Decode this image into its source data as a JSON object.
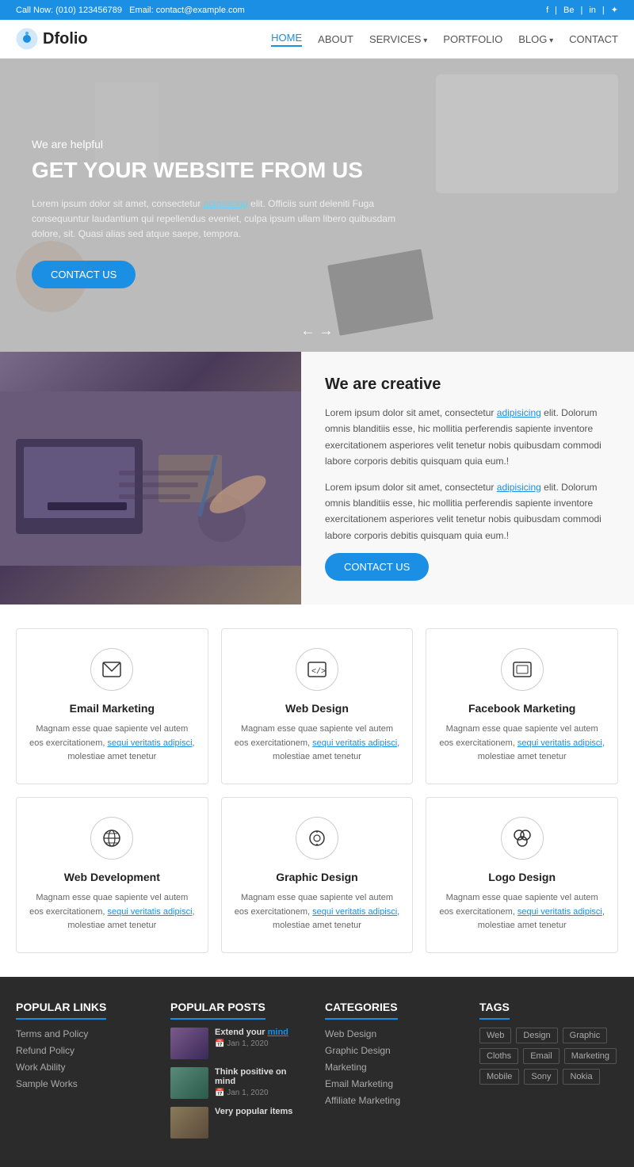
{
  "topbar": {
    "call_label": "Call Now:",
    "phone": "(010) 123456789",
    "email_label": "Email:",
    "email": "contact@example.com",
    "social": [
      "f",
      "Be",
      "in",
      "🐦"
    ]
  },
  "header": {
    "logo_text": "Dfolio",
    "nav": [
      {
        "label": "HOME",
        "active": true,
        "has_arrow": false
      },
      {
        "label": "ABOUT",
        "active": false,
        "has_arrow": false
      },
      {
        "label": "SERVICES",
        "active": false,
        "has_arrow": true
      },
      {
        "label": "PORTFOLIO",
        "active": false,
        "has_arrow": false
      },
      {
        "label": "BLOG",
        "active": false,
        "has_arrow": true
      },
      {
        "label": "CONTACT",
        "active": false,
        "has_arrow": false
      }
    ]
  },
  "hero": {
    "subtitle": "We are helpful",
    "title": "GET YOUR WEBSITE FROM US",
    "description": "Lorem ipsum dolor sit amet, consectetur adipisicing elit. Officiis sunt deleniti Fuga consequuntur laudantium qui repellendus eveniet, culpa ipsum ullam libero quibusdam dolore, sit. Quasi alias sed atque saepe, tempora.",
    "cta_button": "CONTACT US",
    "arrows": "← →"
  },
  "about": {
    "title": "We are creative",
    "text1": "Lorem ipsum dolor sit amet, consectetur adipisicing elit. Dolorum omnis blanditiis esse, hic mollitia perferendis sapiente inventore exercitationem asperiores velit tenetur nobis quibusdam commodi labore corporis debitis quisquam quia eum.!",
    "text2": "Lorem ipsum dolor sit amet, consectetur adipisicing elit. Dolorum omnis blanditiis esse, hic mollitia perferendis sapiente inventore exercitationem asperiores velit tenetur nobis quibusdam commodi labore corporis debitis quisquam quia eum.!",
    "cta_button": "CONTACT US"
  },
  "services": [
    {
      "icon": "✉",
      "title": "Email Marketing",
      "desc": "Magnam esse quae sapiente vel autem eos exercitationem, sequi veritatis adipisci, molestiae amet tenetur"
    },
    {
      "icon": "</>",
      "title": "Web Design",
      "desc": "Magnam esse quae sapiente vel autem eos exercitationem, sequi veritatis adipisci, molestiae amet tenetur"
    },
    {
      "icon": "▣",
      "title": "Facebook Marketing",
      "desc": "Magnam esse quae sapiente vel autem eos exercitationem, sequi veritatis adipisci, molestiae amet tenetur"
    },
    {
      "icon": "🌐",
      "title": "Web Development",
      "desc": "Magnam esse quae sapiente vel autem eos exercitationem, sequi veritatis adipisci, molestiae amet tenetur"
    },
    {
      "icon": "📷",
      "title": "Graphic Design",
      "desc": "Magnam esse quae sapiente vel autem eos exercitationem, sequi veritatis adipisci, molestiae amet tenetur"
    },
    {
      "icon": "◎",
      "title": "Logo Design",
      "desc": "Magnam esse quae sapiente vel autem eos exercitationem, sequi veritatis adipisci, molestiae amet tenetur"
    }
  ],
  "footer": {
    "popular_links": {
      "title": "POPULAR LINKS",
      "items": [
        "Terms and Policy",
        "Refund Policy",
        "Work Ability",
        "Sample Works"
      ]
    },
    "popular_posts": {
      "title": "POPULAR POSTS",
      "posts": [
        {
          "title": "Extend your mind",
          "title_highlight": "mind",
          "date": "Jan 1, 2020"
        },
        {
          "title": "Think positive on mind",
          "date": "Jan 1, 2020"
        },
        {
          "title": "Very popular items",
          "date": ""
        }
      ]
    },
    "categories": {
      "title": "CATEGORIES",
      "items": [
        "Web Design",
        "Graphic Design",
        "Marketing",
        "Email Marketing",
        "Affiliate Marketing"
      ]
    },
    "tags": {
      "title": "TAGS",
      "items": [
        "Web",
        "Design",
        "Graphic",
        "Cloths",
        "Email",
        "Marketing",
        "Mobile",
        "Sony",
        "Nokia"
      ]
    }
  }
}
